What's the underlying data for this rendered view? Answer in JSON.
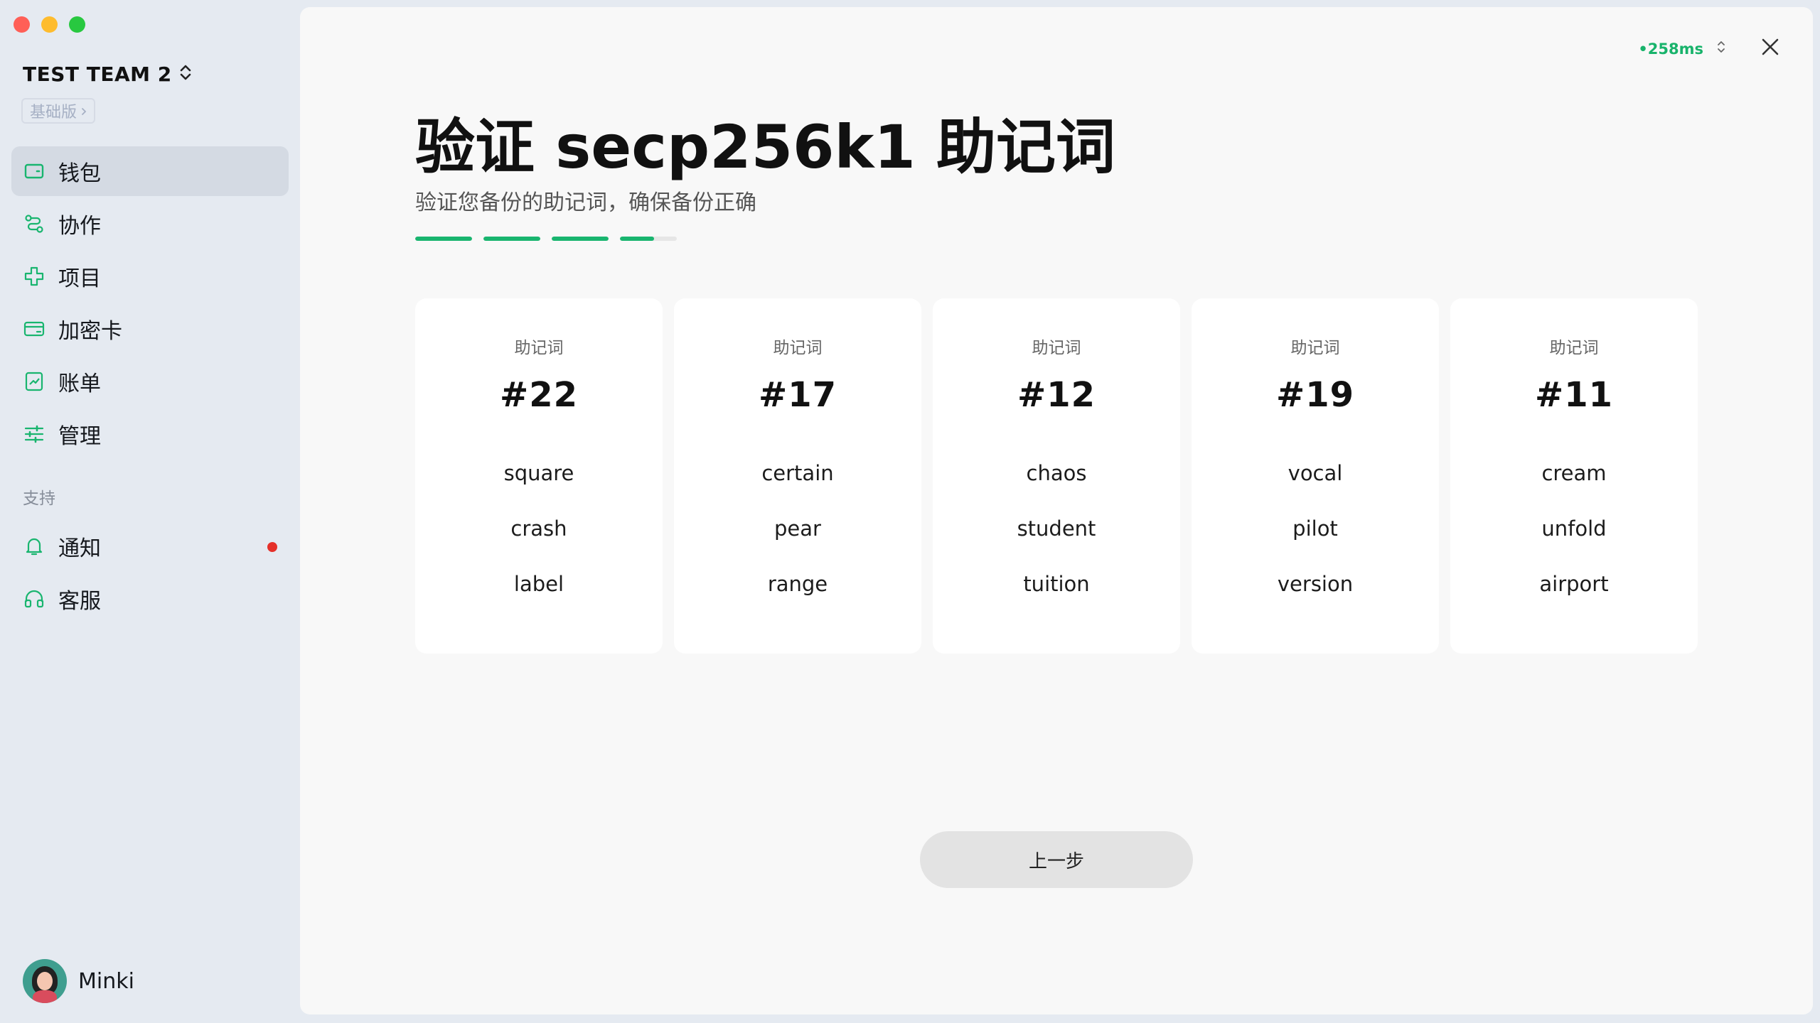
{
  "window": {
    "traffic_lights": [
      "close",
      "minimize",
      "maximize"
    ]
  },
  "sidebar": {
    "team_name": "TEST TEAM 2",
    "plan_badge": "基础版",
    "items": [
      {
        "label": "钱包",
        "icon": "wallet-icon",
        "active": true
      },
      {
        "label": "协作",
        "icon": "collaboration-icon",
        "active": false
      },
      {
        "label": "项目",
        "icon": "project-icon",
        "active": false
      },
      {
        "label": "加密卡",
        "icon": "card-icon",
        "active": false
      },
      {
        "label": "账单",
        "icon": "bill-icon",
        "active": false
      },
      {
        "label": "管理",
        "icon": "settings-sliders-icon",
        "active": false
      }
    ],
    "support_label": "支持",
    "support_items": [
      {
        "label": "通知",
        "icon": "bell-icon",
        "has_notification": true
      },
      {
        "label": "客服",
        "icon": "headset-icon",
        "has_notification": false
      }
    ],
    "user_name": "Minki"
  },
  "header": {
    "latency": "•258ms"
  },
  "main": {
    "title": "验证 secp256k1 助记词",
    "subtitle": "验证您备份的助记词，确保备份正确",
    "progress_fill": [
      1,
      1,
      1,
      0.6,
      0
    ],
    "cards": [
      {
        "label": "助记词",
        "number": "#22",
        "options": [
          "square",
          "crash",
          "label"
        ]
      },
      {
        "label": "助记词",
        "number": "#17",
        "options": [
          "certain",
          "pear",
          "range"
        ]
      },
      {
        "label": "助记词",
        "number": "#12",
        "options": [
          "chaos",
          "student",
          "tuition"
        ]
      },
      {
        "label": "助记词",
        "number": "#19",
        "options": [
          "vocal",
          "pilot",
          "version"
        ]
      },
      {
        "label": "助记词",
        "number": "#11",
        "options": [
          "cream",
          "unfold",
          "airport"
        ]
      }
    ],
    "back_button": "上一步"
  },
  "colors": {
    "accent": "#19b56f",
    "notification": "#e5302a"
  }
}
